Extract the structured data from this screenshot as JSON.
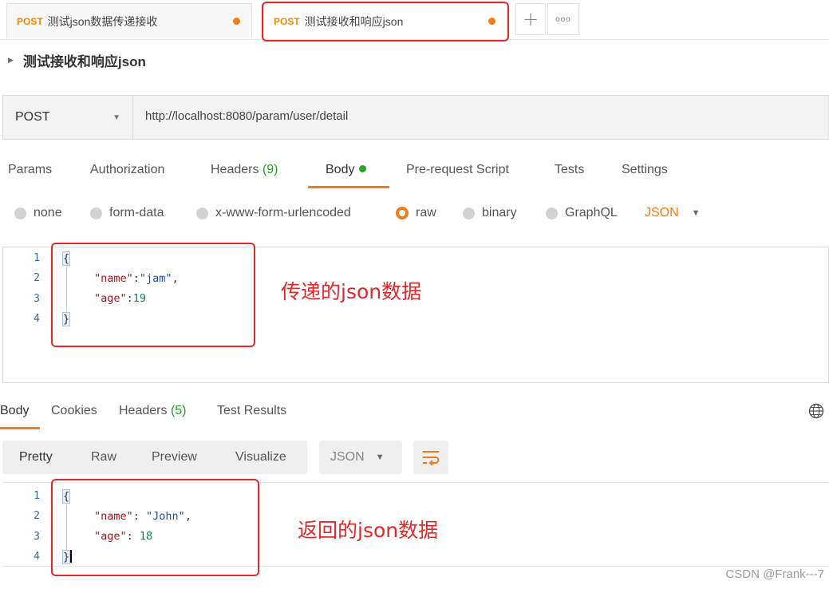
{
  "tabs": [
    {
      "method": "POST",
      "name": "测试json数据传递接收"
    },
    {
      "method": "POST",
      "name": "测试接收和响应json"
    }
  ],
  "tab_more": "ooo",
  "request_name": "测试接收和响应json",
  "request": {
    "method": "POST",
    "url": "http://localhost:8080/param/user/detail"
  },
  "request_tabs": {
    "params": "Params",
    "authorization": "Authorization",
    "headers_label": "Headers",
    "headers_count": "(9)",
    "body": "Body",
    "pre_request": "Pre-request Script",
    "tests": "Tests",
    "settings": "Settings"
  },
  "body_modes": {
    "none": "none",
    "form_data": "form-data",
    "urlencoded": "x-www-form-urlencoded",
    "raw": "raw",
    "binary": "binary",
    "graphql": "GraphQL",
    "format": "JSON"
  },
  "request_body": {
    "line_numbers": [
      "1",
      "2",
      "3",
      "4"
    ],
    "open": "{",
    "k1": "\"name\"",
    "sep1": ":",
    "v1": "\"jam\"",
    "comma1": ",",
    "k2": "\"age\"",
    "sep2": ":",
    "v2": "19",
    "close": "}"
  },
  "annotation_request": "传递的json数据",
  "response_tabs": {
    "body": "Body",
    "cookies": "Cookies",
    "headers_label": "Headers",
    "headers_count": "(5)",
    "test_results": "Test Results"
  },
  "response_views": {
    "pretty": "Pretty",
    "raw": "Raw",
    "preview": "Preview",
    "visualize": "Visualize",
    "format": "JSON"
  },
  "response_body": {
    "line_numbers": [
      "1",
      "2",
      "3",
      "4"
    ],
    "open": "{",
    "k1": "\"name\"",
    "sep1": ": ",
    "v1": "\"John\"",
    "comma1": ",",
    "k2": "\"age\"",
    "sep2": ": ",
    "v2": "18",
    "close": "}"
  },
  "annotation_response": "返回的json数据",
  "watermark": "CSDN @Frank---7",
  "colors": {
    "accent": "#f07c1a",
    "method": "#f28b00",
    "highlight_box": "#e02a2a",
    "count_green": "#21a321"
  }
}
